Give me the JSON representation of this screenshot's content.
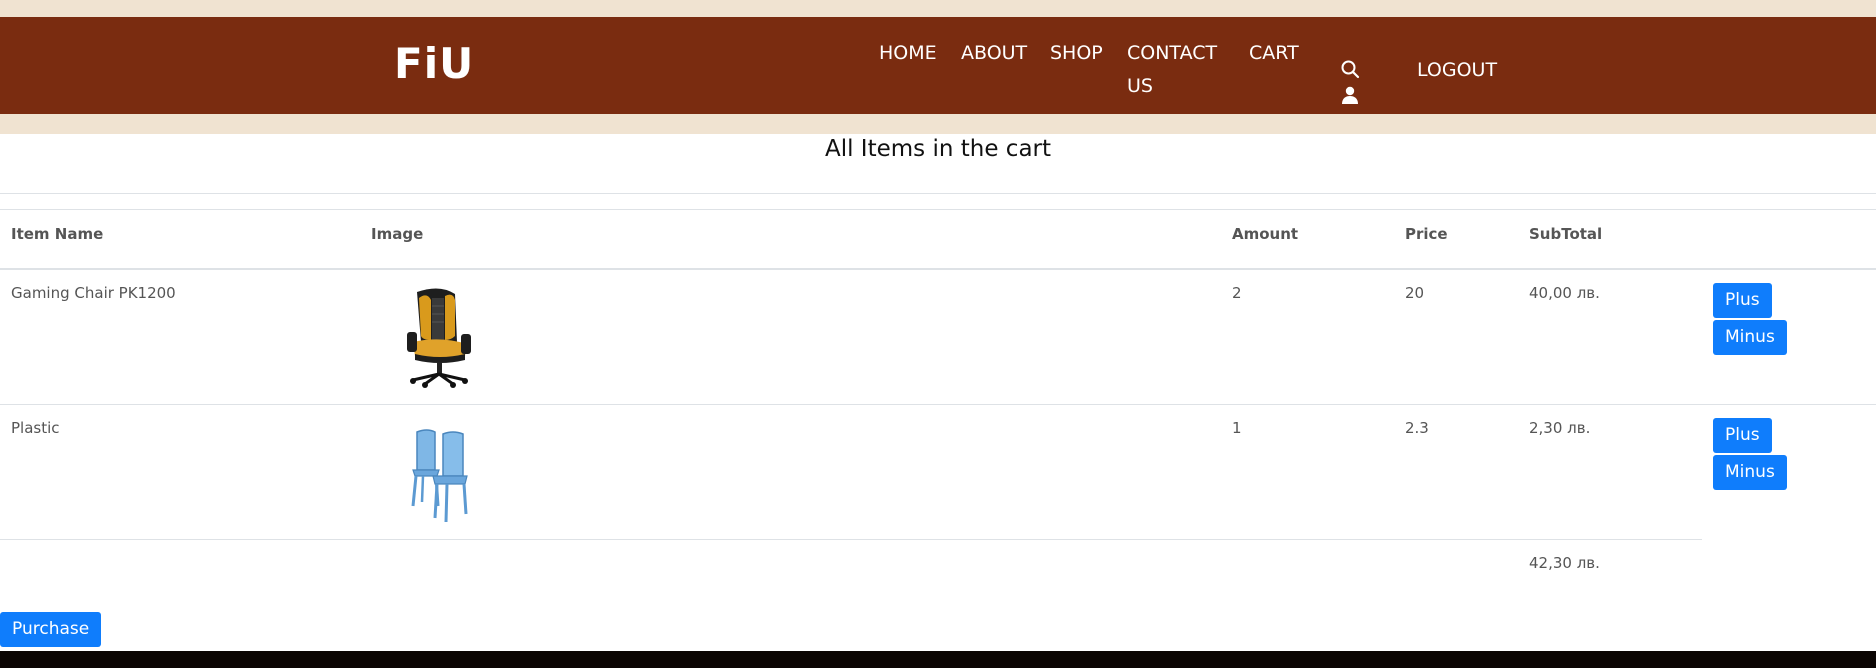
{
  "brand": {
    "logo": "FiU",
    "nav_bg": "#7a2c10",
    "strip_bg": "#f0e3d1",
    "button_color": "#0f7dfc"
  },
  "nav": {
    "home": "HOME",
    "about": "ABOUT",
    "shop": "SHOP",
    "contact": "CONTACT US",
    "cart": "CART",
    "logout": "LOGOUT",
    "icons": [
      "search-icon",
      "user-icon"
    ]
  },
  "page": {
    "heading": "All Items in the cart"
  },
  "table": {
    "headers": {
      "name": "Item Name",
      "image": "Image",
      "amount": "Amount",
      "price": "Price",
      "subtotal": "SubTotal"
    },
    "rows": [
      {
        "name": "Gaming Chair PK1200",
        "amount": "2",
        "price": "20",
        "subtotal": "40,00 лв.",
        "plus": "Plus",
        "minus": "Minus"
      },
      {
        "name": "Plastic",
        "amount": "1",
        "price": "2.3",
        "subtotal": "2,30 лв.",
        "plus": "Plus",
        "minus": "Minus"
      }
    ],
    "total": "42,30 лв."
  },
  "actions": {
    "purchase": "Purchase"
  }
}
